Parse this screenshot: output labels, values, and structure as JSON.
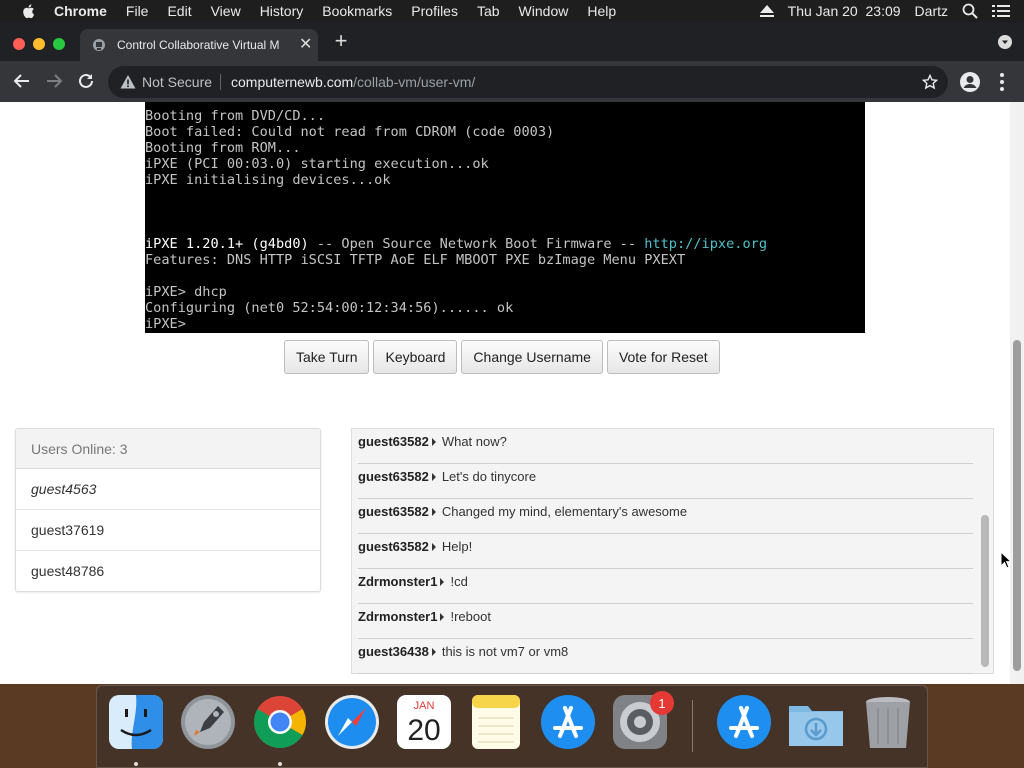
{
  "menubar": {
    "app": "Chrome",
    "items": [
      "File",
      "Edit",
      "View",
      "History",
      "Bookmarks",
      "Profiles",
      "Tab",
      "Window",
      "Help"
    ],
    "datetime": "Thu Jan 20  23:09",
    "user": "Dartz"
  },
  "browser": {
    "tab_title": "Control Collaborative Virtual M",
    "security_label": "Not Secure",
    "url_host": "computernewb.com",
    "url_path": "/collab-vm/user-vm/"
  },
  "console": {
    "lines": [
      {
        "text": "Booting from DVD/CD...",
        "style": ""
      },
      {
        "text": "Boot failed: Could not read from CDROM (code 0003)",
        "style": ""
      },
      {
        "text": "Booting from ROM...",
        "style": ""
      },
      {
        "text": "iPXE (PCI 00:03.0) starting execution...ok",
        "style": ""
      },
      {
        "text": "iPXE initialising devices...ok",
        "style": ""
      },
      {
        "text": "",
        "style": ""
      },
      {
        "text": "",
        "style": ""
      },
      {
        "text": "",
        "style": ""
      },
      {
        "text": "iPXE 1.20.1+ (g4bd0)",
        "style": "bright",
        "rest": " -- Open Source Network Boot Firmware -- ",
        "link": "http://ipxe.org"
      },
      {
        "text": "Features: DNS HTTP iSCSI TFTP AoE ELF MBOOT PXE bzImage Menu PXEXT",
        "style": ""
      },
      {
        "text": "",
        "style": ""
      },
      {
        "text": "iPXE> dhcp",
        "style": ""
      },
      {
        "text": "Configuring (net0 52:54:00:12:34:56)...... ok",
        "style": ""
      },
      {
        "text": "iPXE>",
        "style": ""
      }
    ]
  },
  "vm_buttons": {
    "take_turn": "Take Turn",
    "keyboard": "Keyboard",
    "change_username": "Change Username",
    "vote_reset": "Vote for Reset"
  },
  "users": {
    "header": "Users Online: 3",
    "list": [
      "guest4563",
      "guest37619",
      "guest48786"
    ]
  },
  "chat": {
    "messages": [
      {
        "user": "guest63582",
        "text": "What now?"
      },
      {
        "user": "guest63582",
        "text": "Let's do tinycore"
      },
      {
        "user": "guest63582",
        "text": "Changed my mind, elementary's awesome"
      },
      {
        "user": "guest63582",
        "text": "Help!"
      },
      {
        "user": "Zdrmonster1",
        "text": "!cd"
      },
      {
        "user": "Zdrmonster1",
        "text": "!reboot"
      },
      {
        "user": "guest36438",
        "text": "this is not vm7 or vm8"
      }
    ]
  },
  "dock": {
    "calendar_month": "JAN",
    "calendar_day": "20",
    "prefs_badge": "1"
  },
  "colors": {
    "accent_cyan": "#4fc1c9",
    "badge_red": "#e53935"
  }
}
